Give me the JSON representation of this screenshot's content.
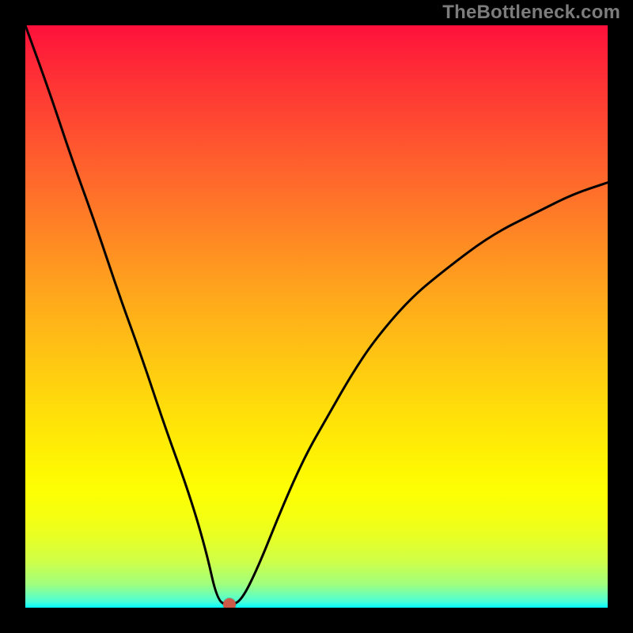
{
  "watermark_text": "TheBottleneck.com",
  "colors": {
    "page_bg": "#000000",
    "curve_stroke": "#000000",
    "marker_fill": "#cc5a48"
  },
  "chart_data": {
    "type": "line",
    "title": "",
    "xlabel": "",
    "ylabel": "",
    "xlim": [
      0,
      100
    ],
    "ylim": [
      0,
      100
    ],
    "grid": false,
    "description": "Bottleneck curve over a vertical red→yellow→green gradient. The curve descends steeply from the top-left, reaches zero near x≈33, stays near zero briefly, then rises with decreasing slope toward the right. A red dot marks the minimum near the bottom.",
    "series": [
      {
        "name": "bottleneck_curve",
        "x": [
          0,
          4,
          8,
          12,
          16,
          20,
          24,
          28,
          31,
          33,
          35,
          37,
          40,
          44,
          48,
          52,
          56,
          60,
          66,
          72,
          80,
          88,
          94,
          100
        ],
        "values": [
          100,
          89,
          77,
          66,
          54,
          43,
          31,
          20,
          10,
          1,
          0.5,
          1,
          7,
          17,
          26,
          33,
          40,
          46,
          53,
          58,
          64,
          68,
          71,
          73
        ]
      }
    ],
    "marker": {
      "x": 35,
      "y": 0.5
    },
    "gradient_stops": [
      {
        "pos": 0,
        "color": "#fe103b"
      },
      {
        "pos": 8,
        "color": "#fe2d36"
      },
      {
        "pos": 22,
        "color": "#ff5a2e"
      },
      {
        "pos": 34,
        "color": "#ff8026"
      },
      {
        "pos": 46,
        "color": "#ffa61c"
      },
      {
        "pos": 58,
        "color": "#ffc812"
      },
      {
        "pos": 68,
        "color": "#ffe308"
      },
      {
        "pos": 76,
        "color": "#fef603"
      },
      {
        "pos": 80,
        "color": "#fdff04"
      },
      {
        "pos": 84,
        "color": "#f6ff0f"
      },
      {
        "pos": 88,
        "color": "#e7ff26"
      },
      {
        "pos": 92,
        "color": "#cfff48"
      },
      {
        "pos": 96,
        "color": "#a0ff7e"
      },
      {
        "pos": 99,
        "color": "#4affd8"
      },
      {
        "pos": 100,
        "color": "#00ffff"
      }
    ]
  }
}
